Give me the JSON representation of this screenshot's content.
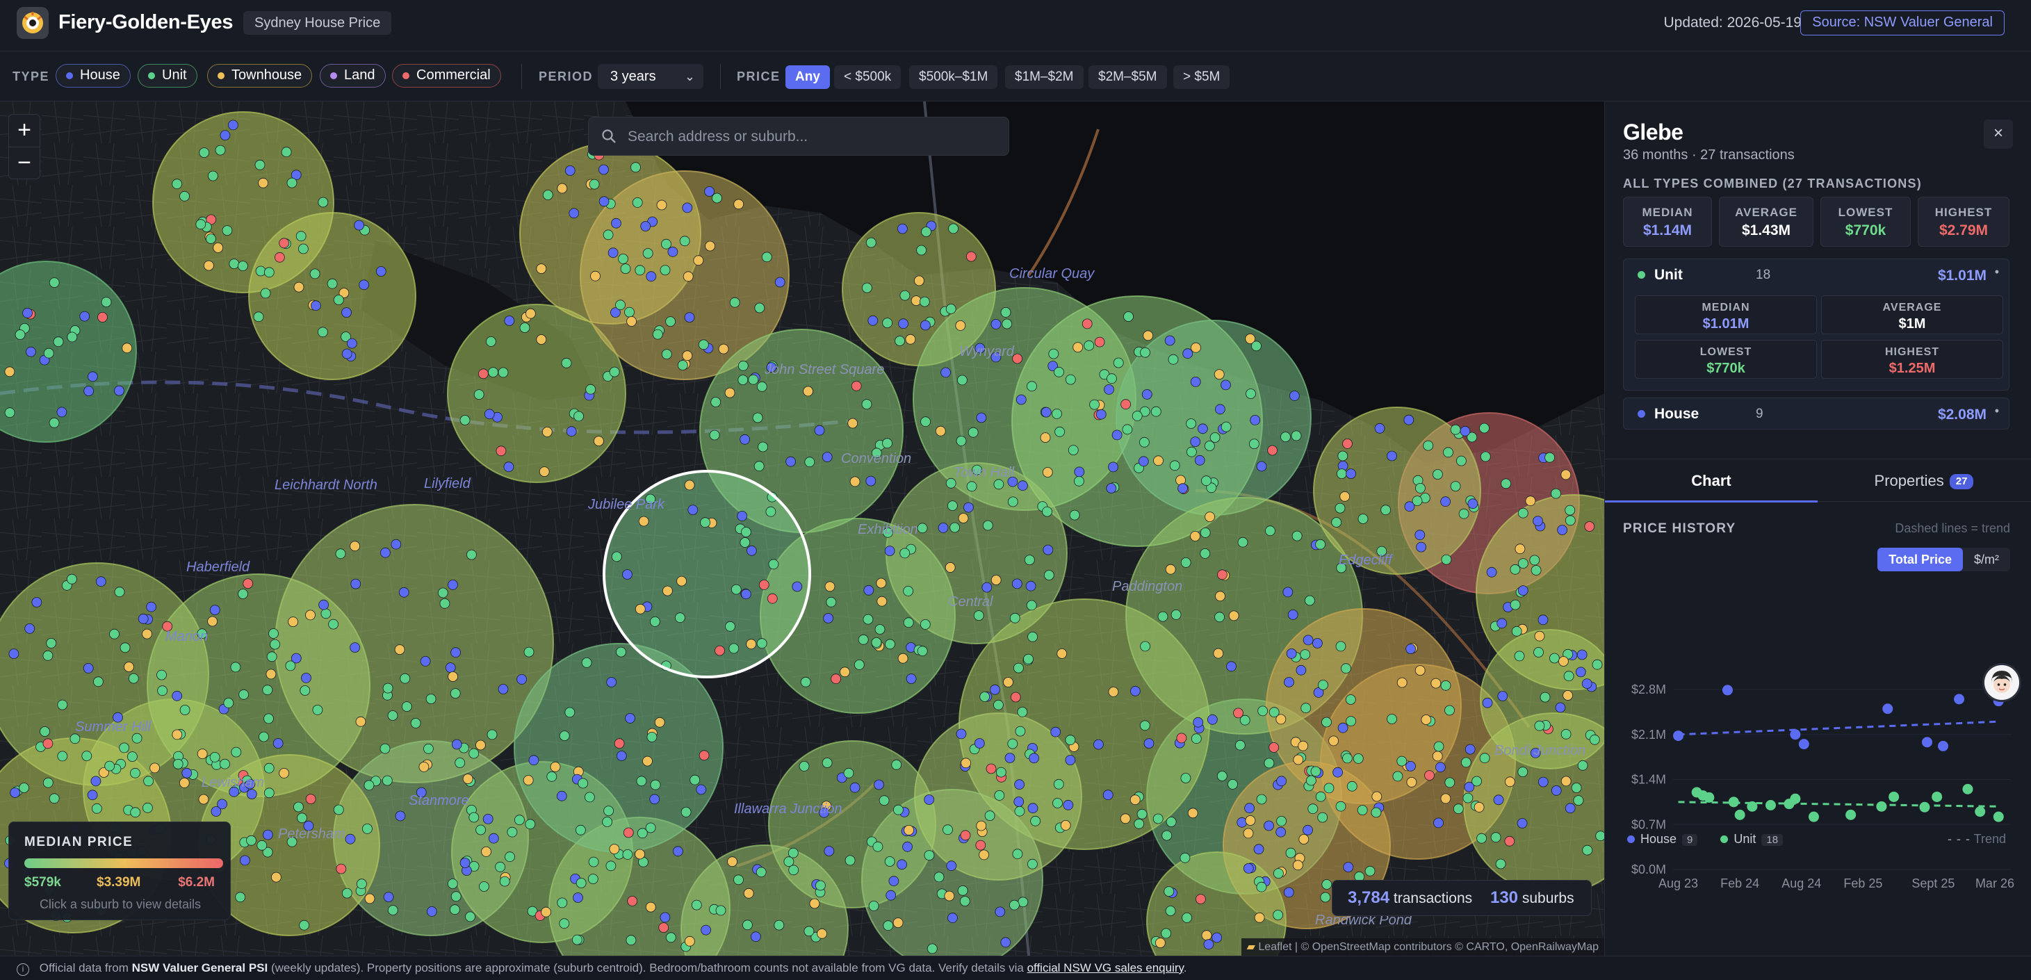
{
  "header": {
    "app_title": "Fiery-Golden-Eyes",
    "subtitle": "Sydney House Price",
    "updated": "Updated: 2026-05-19",
    "source_label": "Source: NSW Valuer General"
  },
  "filters": {
    "type_label": "TYPE",
    "types": [
      {
        "label": "House",
        "color": "#5b6cf0"
      },
      {
        "label": "Unit",
        "color": "#5cd18a"
      },
      {
        "label": "Townhouse",
        "color": "#f0c05a"
      },
      {
        "label": "Land",
        "color": "#b48cf0"
      },
      {
        "label": "Commercial",
        "color": "#f06a6a"
      }
    ],
    "period_label": "PERIOD",
    "period_value": "3 years",
    "price_label": "PRICE",
    "price_options": [
      "Any",
      "< $500k",
      "$500k–$1M",
      "$1M–$2M",
      "$2M–$5M",
      "> $5M"
    ],
    "price_selected": "Any"
  },
  "map": {
    "zoom_in": "+",
    "zoom_out": "−",
    "search_placeholder": "Search address or suburb...",
    "place_labels": [
      "Circular Quay",
      "John Street Square",
      "Convention",
      "Town Hall",
      "Jubilee Park",
      "Leichhardt North",
      "Lilyfield",
      "Haberfield",
      "Marion",
      "Summer Hill",
      "Lewisham",
      "Petersham",
      "Stanmore",
      "Illawarra Junction",
      "Exhibition",
      "Central",
      "Edgecliff",
      "Randwick Pond",
      "Paddington",
      "Wynyard",
      "Bondi Junction"
    ],
    "legend": {
      "title": "MEDIAN PRICE",
      "min": "$579k",
      "mid": "$3.39M",
      "max": "$6.2M",
      "hint": "Click a suburb to view details"
    },
    "stats": {
      "transactions_count": "3,784",
      "transactions_label": "transactions",
      "suburbs_count": "130",
      "suburbs_label": "suburbs"
    },
    "attribution": "Leaflet | © OpenStreetMap contributors © CARTO, OpenRailwayMap"
  },
  "panel": {
    "suburb": "Glebe",
    "summary": "36 months · 27 transactions",
    "combined_label": "ALL TYPES COMBINED (27 TRANSACTIONS)",
    "stats": [
      {
        "label": "MEDIAN",
        "value": "$1.14M",
        "color": "#8f9cff"
      },
      {
        "label": "AVERAGE",
        "value": "$1.43M",
        "color": "#ffffff"
      },
      {
        "label": "LOWEST",
        "value": "$770k",
        "color": "#6fdc8c"
      },
      {
        "label": "HIGHEST",
        "value": "$2.79M",
        "color": "#f06a6a"
      }
    ],
    "types": [
      {
        "name": "Unit",
        "count": "18",
        "median": "$1.01M",
        "color": "#5cd18a",
        "details": [
          {
            "label": "MEDIAN",
            "value": "$1.01M",
            "color": "#8f9cff"
          },
          {
            "label": "AVERAGE",
            "value": "$1M",
            "color": "#ffffff"
          },
          {
            "label": "LOWEST",
            "value": "$770k",
            "color": "#6fdc8c"
          },
          {
            "label": "HIGHEST",
            "value": "$1.25M",
            "color": "#f06a6a"
          }
        ]
      },
      {
        "name": "House",
        "count": "9",
        "median": "$2.08M",
        "color": "#5b6cf0"
      }
    ],
    "caret": "•",
    "tabs": {
      "chart": "Chart",
      "properties": "Properties",
      "properties_count": "27"
    },
    "chart_section": {
      "title": "PRICE HISTORY",
      "note": "Dashed lines = trend",
      "toggle_total": "Total Price",
      "toggle_sqm": "$/m²",
      "legend_house": "House",
      "legend_house_count": "9",
      "legend_unit": "Unit",
      "legend_unit_count": "18",
      "legend_trend": "Trend"
    }
  },
  "chart_data": {
    "type": "scatter",
    "title": "PRICE HISTORY",
    "ylim": [
      0,
      2.8
    ],
    "yticks": [
      {
        "value": 2.8,
        "label": "$2.8M"
      },
      {
        "value": 2.1,
        "label": "$2.1M"
      },
      {
        "value": 1.4,
        "label": "$1.4M"
      },
      {
        "value": 0.7,
        "label": "$0.7M"
      },
      {
        "value": 0.0,
        "label": "$0.0M"
      }
    ],
    "xlim": [
      2023.58,
      2026.3
    ],
    "xticks": [
      {
        "value": 2023.6,
        "label": "Aug 23"
      },
      {
        "value": 2024.1,
        "label": "Feb 24"
      },
      {
        "value": 2024.6,
        "label": "Aug 24"
      },
      {
        "value": 2025.1,
        "label": "Feb 25"
      },
      {
        "value": 2025.67,
        "label": "Sept 25"
      },
      {
        "value": 2026.17,
        "label": "Mar 26"
      }
    ],
    "series": [
      {
        "name": "House",
        "color": "#5b6cf0",
        "points": [
          [
            2023.6,
            2.08
          ],
          [
            2024.0,
            2.79
          ],
          [
            2024.55,
            2.1
          ],
          [
            2024.62,
            1.95
          ],
          [
            2025.3,
            2.5
          ],
          [
            2025.62,
            1.98
          ],
          [
            2025.75,
            1.92
          ],
          [
            2025.88,
            2.65
          ],
          [
            2026.2,
            2.62
          ]
        ],
        "trend": [
          [
            2023.6,
            2.1
          ],
          [
            2026.2,
            2.3
          ]
        ]
      },
      {
        "name": "Unit",
        "color": "#5cd18a",
        "points": [
          [
            2023.75,
            1.2
          ],
          [
            2023.8,
            1.15
          ],
          [
            2023.85,
            1.12
          ],
          [
            2024.05,
            1.05
          ],
          [
            2024.1,
            0.85
          ],
          [
            2024.2,
            0.98
          ],
          [
            2024.35,
            1.0
          ],
          [
            2024.5,
            1.02
          ],
          [
            2024.55,
            1.1
          ],
          [
            2024.7,
            0.82
          ],
          [
            2025.0,
            0.85
          ],
          [
            2025.25,
            0.98
          ],
          [
            2025.35,
            1.13
          ],
          [
            2025.6,
            0.97
          ],
          [
            2025.7,
            1.13
          ],
          [
            2025.95,
            1.25
          ],
          [
            2026.05,
            0.9
          ],
          [
            2026.2,
            0.82
          ]
        ],
        "trend": [
          [
            2023.6,
            1.05
          ],
          [
            2026.2,
            0.98
          ]
        ]
      }
    ]
  },
  "footer": {
    "pre": "Official data from",
    "source_bold": "NSW Valuer General PSI",
    "mid": "(weekly updates). Property positions are approximate (suburb centroid). Bedroom/bathroom counts not available from VG data. Verify details via",
    "link": "official NSW VG sales enquiry",
    "end": "."
  }
}
